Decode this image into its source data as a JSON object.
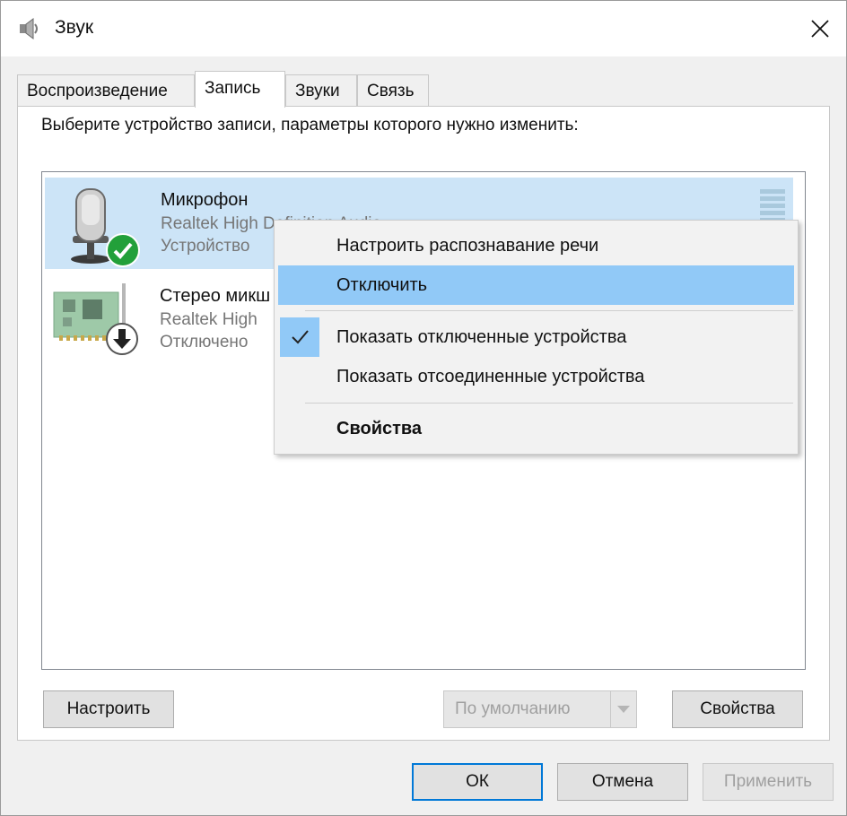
{
  "window": {
    "title": "Звук",
    "icon": "speaker-icon"
  },
  "tabs": [
    {
      "label": "Воспроизведение",
      "active": false
    },
    {
      "label": "Запись",
      "active": true
    },
    {
      "label": "Звуки",
      "active": false
    },
    {
      "label": "Связь",
      "active": false
    }
  ],
  "panel": {
    "description": "Выберите устройство записи, параметры которого нужно изменить:"
  },
  "devices": [
    {
      "name": "Микрофон",
      "driver": "Realtek High Definition Audio",
      "status": "Устройство",
      "icon": "microphone-icon",
      "badge": "default-check-icon",
      "selected": true
    },
    {
      "name": "Стерео микш",
      "driver": "Realtek High",
      "status": "Отключено",
      "icon": "sound-card-icon",
      "badge": "disabled-arrow-icon",
      "selected": false
    }
  ],
  "buttons": {
    "configure": "Настроить",
    "set_default": "По умолчанию",
    "properties": "Свойства",
    "ok": "ОК",
    "cancel": "Отмена",
    "apply": "Применить"
  },
  "context_menu": {
    "items": [
      {
        "label": "Настроить распознавание речи",
        "checked": false,
        "highlighted": false,
        "bold": false
      },
      {
        "label": "Отключить",
        "checked": false,
        "highlighted": true,
        "bold": false
      },
      {
        "label": "Показать отключенные устройства",
        "checked": true,
        "highlighted": false,
        "bold": false
      },
      {
        "label": "Показать отсоединенные устройства",
        "checked": false,
        "highlighted": false,
        "bold": false
      },
      {
        "label": "Свойства",
        "checked": false,
        "highlighted": false,
        "bold": true
      }
    ]
  },
  "colors": {
    "selection": "#cce4f7",
    "menu_highlight": "#91c9f7",
    "default_button_border": "#0078d7",
    "check_badge": "#22a03a"
  }
}
